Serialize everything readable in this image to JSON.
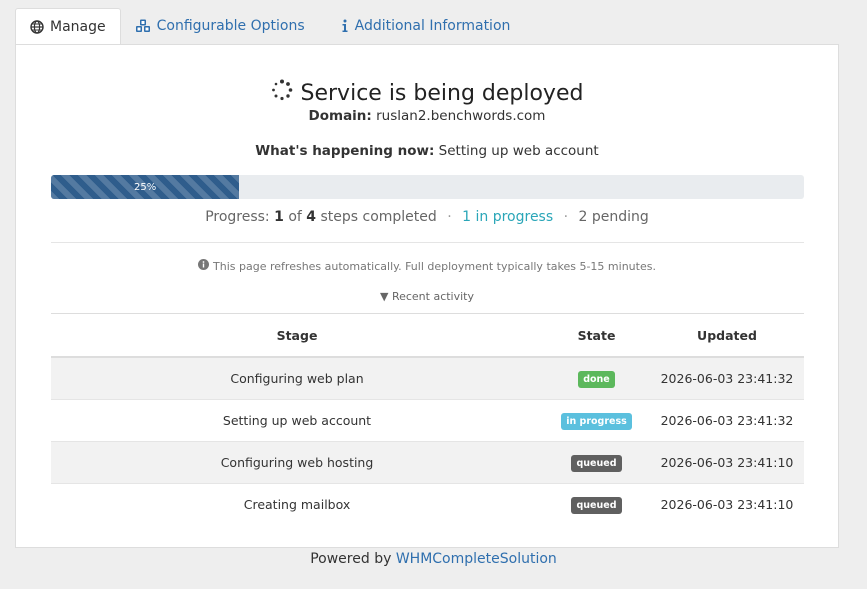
{
  "tabs": [
    {
      "label": "Manage",
      "icon": "globe-icon",
      "active": true
    },
    {
      "label": "Configurable Options",
      "icon": "cubes-icon",
      "active": false
    },
    {
      "label": "Additional Information",
      "icon": "info-icon",
      "active": false
    }
  ],
  "status": {
    "title": "Service is being deployed",
    "domain_label": "Domain:",
    "domain_value": "ruslan2.benchwords.com",
    "now_label": "What's happening now:",
    "now_value": "Setting up web account"
  },
  "progress": {
    "percent": 25,
    "percent_label": "25%",
    "summary_prefix": "Progress:",
    "completed": "1",
    "of_text": "of",
    "total": "4",
    "steps_text": "steps completed",
    "in_progress_text": "1 in progress",
    "pending_text": "2 pending",
    "separator": "·"
  },
  "refresh_note": "This page refreshes automatically. Full deployment typically takes 5-15 minutes.",
  "activity_toggle": "▼ Recent activity",
  "table": {
    "headers": {
      "stage": "Stage",
      "state": "State",
      "updated": "Updated"
    },
    "rows": [
      {
        "stage": "Configuring web plan",
        "state": "done",
        "updated": "2026-06-03 23:41:32"
      },
      {
        "stage": "Setting up web account",
        "state": "in progress",
        "updated": "2026-06-03 23:41:32"
      },
      {
        "stage": "Configuring web hosting",
        "state": "queued",
        "updated": "2026-06-03 23:41:10"
      },
      {
        "stage": "Creating mailbox",
        "state": "queued",
        "updated": "2026-06-03 23:41:10"
      }
    ]
  },
  "state_colors": {
    "done": "#5cb85c",
    "in progress": "#5bc0de",
    "queued": "#606060"
  },
  "footer": {
    "prefix": "Powered by",
    "link_text": "WHMCompleteSolution"
  }
}
